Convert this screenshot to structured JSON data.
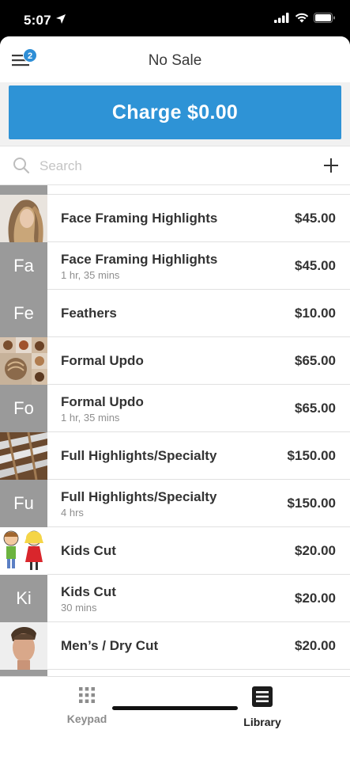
{
  "status": {
    "time": "5:07",
    "icons": [
      "location-arrow-icon",
      "signal-icon",
      "wifi-icon",
      "battery-icon"
    ]
  },
  "header": {
    "title": "No Sale",
    "menu_badge": "2"
  },
  "charge": {
    "label": "Charge $0.00"
  },
  "search": {
    "placeholder": "Search"
  },
  "items": [
    {
      "abbr": "",
      "thumb": "photo-hair-highlights",
      "name": "Face Framing Highlights",
      "duration": "",
      "price": "$45.00"
    },
    {
      "abbr": "Fa",
      "thumb": "",
      "name": "Face Framing Highlights",
      "duration": "1 hr, 35 mins",
      "price": "$45.00"
    },
    {
      "abbr": "Fe",
      "thumb": "",
      "name": "Feathers",
      "duration": "",
      "price": "$10.00"
    },
    {
      "abbr": "",
      "thumb": "photo-updo-collage",
      "name": "Formal Updo",
      "duration": "",
      "price": "$65.00"
    },
    {
      "abbr": "Fo",
      "thumb": "",
      "name": "Formal Updo",
      "duration": "1 hr, 35 mins",
      "price": "$65.00"
    },
    {
      "abbr": "",
      "thumb": "photo-foil-highlights",
      "name": "Full Highlights/Specialty",
      "duration": "",
      "price": "$150.00"
    },
    {
      "abbr": "Fu",
      "thumb": "",
      "name": "Full Highlights/Specialty",
      "duration": "4 hrs",
      "price": "$150.00"
    },
    {
      "abbr": "",
      "thumb": "cartoon-kids",
      "name": "Kids Cut",
      "duration": "",
      "price": "$20.00"
    },
    {
      "abbr": "Ki",
      "thumb": "",
      "name": "Kids Cut",
      "duration": "30 mins",
      "price": "$20.00"
    },
    {
      "abbr": "",
      "thumb": "photo-mens-cut",
      "name": "Men’s / Dry Cut",
      "duration": "",
      "price": "$20.00"
    }
  ],
  "tabs": [
    {
      "label": "Keypad",
      "icon": "keypad-icon",
      "active": false
    },
    {
      "label": "Library",
      "icon": "library-icon",
      "active": true
    }
  ],
  "colors": {
    "accent": "#2e93d6",
    "badge": "#2e8ed6",
    "abbr_tile": "#9a9a9a"
  }
}
